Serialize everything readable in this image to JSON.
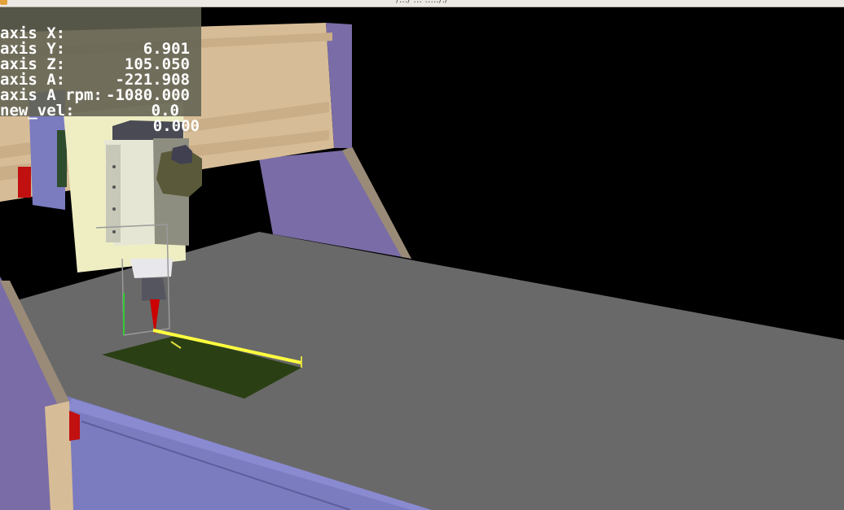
{
  "window": {
    "title": "/.../ ... ....././"
  },
  "dro": [
    {
      "label": "axis X:",
      "value": "6.901"
    },
    {
      "label": "axis Y:",
      "value": "105.050"
    },
    {
      "label": "axis Z:",
      "value": "-221.908"
    },
    {
      "label": "axis A:",
      "value": "-1080.000"
    },
    {
      "label": "axis A rpm:",
      "value": "0.0"
    },
    {
      "label": "new_vel:",
      "value": "0.000"
    }
  ],
  "colors": {
    "background": "#000000",
    "table": "#696969",
    "gantry_beam": "#d7bd97",
    "gantry_side": "#7a6ca6",
    "rail": "#7b7bc0",
    "spindle": "#8e8e80",
    "tool": "#cc0000",
    "workpiece": "#2b3f14",
    "toolpath": "#ffff40",
    "dro_background": "#626252"
  }
}
